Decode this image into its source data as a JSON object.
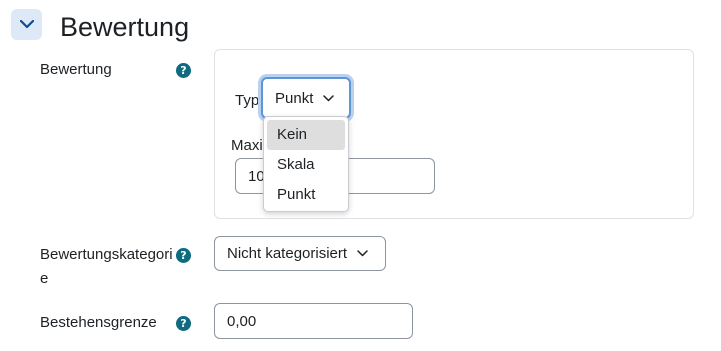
{
  "section": {
    "title": "Bewertung"
  },
  "grade": {
    "label": "Bewertung",
    "type_label": "Typ",
    "type_selected": "Punkt",
    "type_options": [
      "Kein",
      "Skala",
      "Punkt"
    ],
    "max_label": "Maxi",
    "max_value": "10"
  },
  "category": {
    "label_line1": "Bewertungskategori",
    "label_line2": "e",
    "selected": "Nicht kategorisiert"
  },
  "pass": {
    "label": "Bestehensgrenze",
    "value": "0,00"
  },
  "icons": {
    "help": "question-circle-icon",
    "chevron": "chevron-down-icon"
  },
  "colors": {
    "accent": "#0f6b80",
    "focus": "#5d95d6",
    "header_btn_bg": "#dde9f6"
  }
}
